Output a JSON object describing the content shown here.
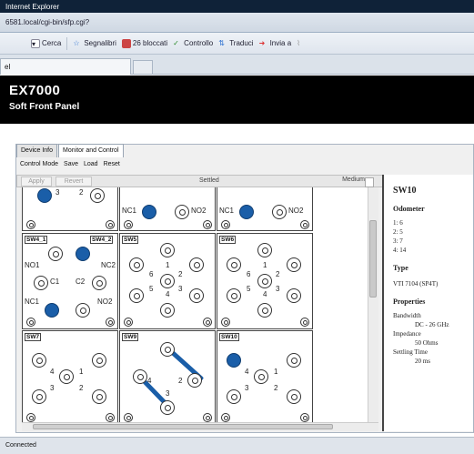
{
  "browser": {
    "window_title": "Internet Explorer",
    "address": "6581.local/cgi-bin/sfp.cgi?",
    "toolbar": {
      "search_label": "Cerca",
      "bookmarks_label": "Segnalibri",
      "blocked_label": "26 bloccati",
      "check_label": "Controllo",
      "translate_label": "Traduci",
      "send_label": "Invia a"
    },
    "tab_label": "el"
  },
  "header": {
    "title": "EX7000",
    "subtitle": "Soft Front Panel"
  },
  "panel": {
    "tabs": [
      {
        "label": "Device Info"
      },
      {
        "label": "Monitor and Control"
      }
    ],
    "menu": [
      {
        "label": "Control Mode"
      },
      {
        "label": "Save"
      },
      {
        "label": "Load"
      },
      {
        "label": "Reset"
      }
    ],
    "apply_label": "Apply",
    "revert_label": "Revert",
    "state_label": "Settled",
    "speed_value": "Medium"
  },
  "switches": {
    "nc1": "NC1",
    "nc2": "NC2",
    "no1": "NO1",
    "no2": "NO2",
    "c1": "C1",
    "c2": "C2",
    "sw4_1": "SW4_1",
    "sw4_2": "SW4_2",
    "sw5": "SW5",
    "sw6": "SW6",
    "sw7": "SW7",
    "sw9": "SW9",
    "sw10": "SW10",
    "n1": "1",
    "n2": "2",
    "n3": "3",
    "n4": "4",
    "n5": "5",
    "n6": "6"
  },
  "properties": {
    "title": "SW10",
    "odometer_heading": "Odometer",
    "odometer": [
      "1: 6",
      "2: 5",
      "3: 7",
      "4: 14"
    ],
    "type_heading": "Type",
    "type_value": "VTI 7104 (SP4T)",
    "properties_heading": "Properties",
    "bandwidth_label": "Bandwidth",
    "bandwidth_value": "DC - 26 GHz",
    "impedance_label": "Impedance",
    "impedance_value": "50 Ohms",
    "settling_label": "Settling Time",
    "settling_value": "20 ms"
  },
  "status": {
    "text": "Connected"
  },
  "colors": {
    "selected_port": "#1a5ea8",
    "header_bg": "#000000"
  }
}
